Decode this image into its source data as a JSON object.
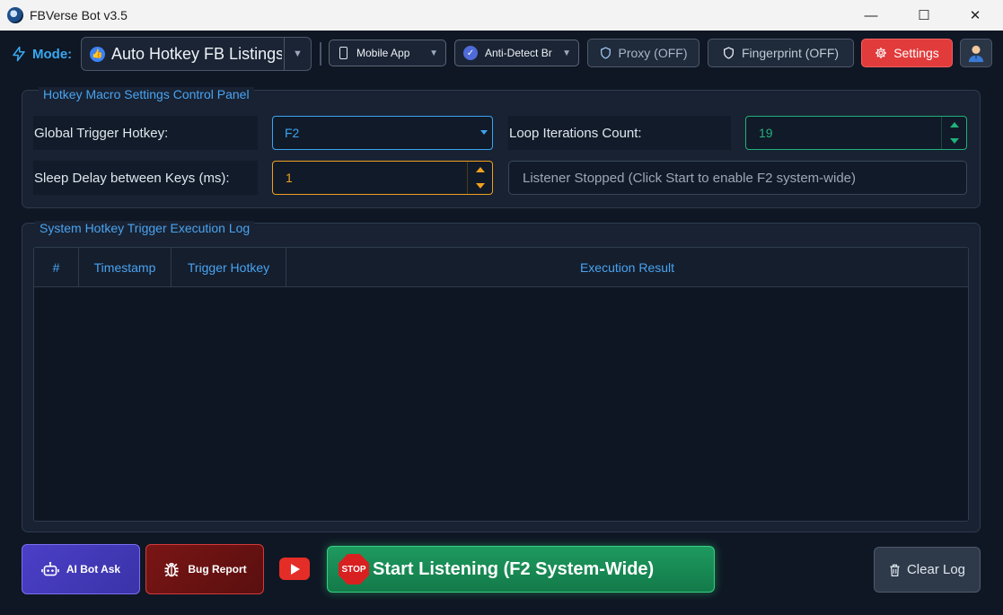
{
  "window": {
    "title": "FBVerse Bot v3.5",
    "minimize": "—",
    "maximize": "☐",
    "close": "✕"
  },
  "toolbar": {
    "mode_label": "Mode:",
    "mode_value": "Auto Hotkey FB Listings",
    "platform_value": "Mobile App",
    "browser_value": "Anti-Detect Br",
    "proxy_label": "Proxy (OFF)",
    "fingerprint_label": "Fingerprint (OFF)",
    "settings_label": "Settings"
  },
  "macro_panel": {
    "title": "Hotkey Macro Settings  Control Panel",
    "trigger_label": "Global Trigger Hotkey:",
    "trigger_value": "F2",
    "loop_label": "Loop Iterations Count:",
    "loop_value": "19",
    "delay_label": "Sleep Delay between Keys (ms):",
    "delay_value": "1",
    "status_text": "Listener Stopped (Click Start to enable F2 system-wide)"
  },
  "log_panel": {
    "title": "System Hotkey Trigger Execution Log",
    "columns": [
      "#",
      "Timestamp",
      "Trigger Hotkey",
      "Execution Result"
    ]
  },
  "bottom": {
    "ai_label": "AI Bot Ask",
    "bug_label": "Bug Report",
    "stop_text": "STOP",
    "start_label": "Start Listening (F2 System-Wide)",
    "clear_label": "Clear Log"
  },
  "colors": {
    "accent": "#3ba4f0",
    "settings_red": "#e23b3b",
    "loop_green": "#22b07a",
    "delay_orange": "#f0a020",
    "start_green": "#1e9a5f"
  }
}
